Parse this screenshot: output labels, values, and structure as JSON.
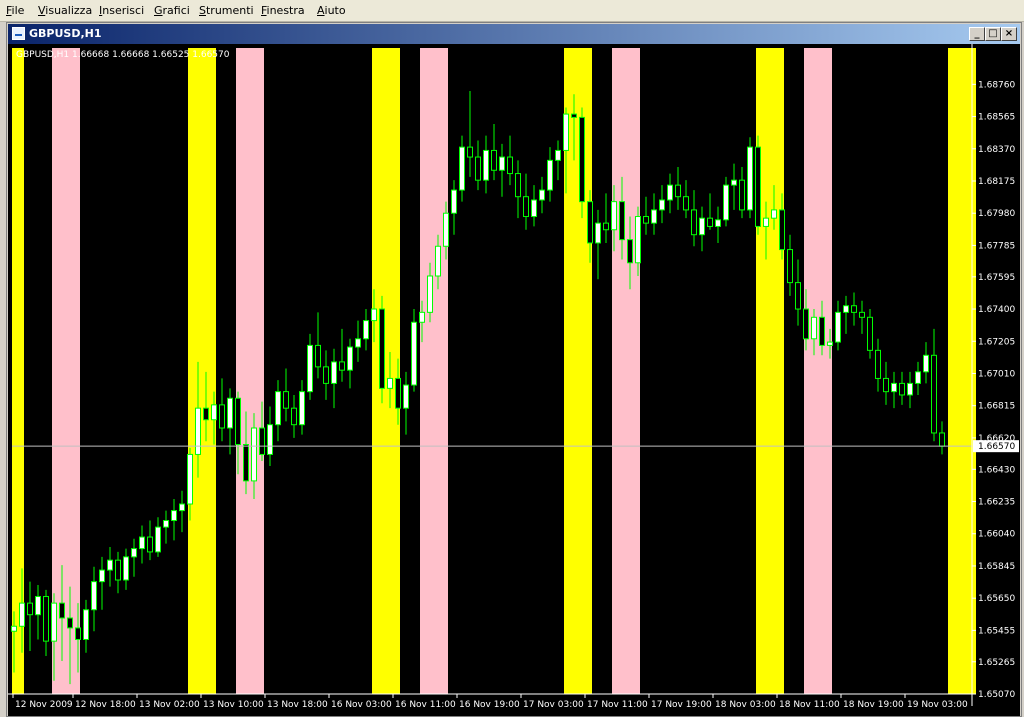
{
  "menu": [
    "File",
    "Visualizza",
    "Inserisci",
    "Grafici",
    "Strumenti",
    "Finestra",
    "Aiuto"
  ],
  "window": {
    "title": "GBPUSD,H1",
    "buttons": {
      "minimize": "_",
      "maximize": "□",
      "close": "×"
    }
  },
  "chart_data": {
    "type": "candlestick",
    "symbol": "GBPUSD",
    "timeframe": "H1",
    "info_line": "GBPUSD,H1  1.66668 1.66668 1.66525 1.66570",
    "current_price": "1.66570",
    "ylim": [
      1.6507,
      1.6898
    ],
    "y_ticks": [
      "1.68760",
      "1.68565",
      "1.68370",
      "1.68175",
      "1.67980",
      "1.67785",
      "1.67595",
      "1.67400",
      "1.67205",
      "1.67010",
      "1.66815",
      "1.66620",
      "1.66430",
      "1.66235",
      "1.66040",
      "1.65845",
      "1.65650",
      "1.65455",
      "1.65265",
      "1.65070"
    ],
    "x_ticks": [
      "12 Nov 2009",
      "12 Nov 18:00",
      "13 Nov 02:00",
      "13 Nov 10:00",
      "13 Nov 18:00",
      "16 Nov 03:00",
      "16 Nov 11:00",
      "16 Nov 19:00",
      "17 Nov 03:00",
      "17 Nov 11:00",
      "17 Nov 19:00",
      "18 Nov 03:00",
      "18 Nov 11:00",
      "18 Nov 19:00",
      "19 Nov 03:00"
    ],
    "session_bands": [
      {
        "type": "yellow",
        "start": 0,
        "end": 1
      },
      {
        "type": "pink",
        "start": 5,
        "end": 8
      },
      {
        "type": "yellow",
        "start": 22,
        "end": 25
      },
      {
        "type": "pink",
        "start": 28,
        "end": 31
      },
      {
        "type": "yellow",
        "start": 45,
        "end": 48
      },
      {
        "type": "pink",
        "start": 51,
        "end": 54
      },
      {
        "type": "yellow",
        "start": 69,
        "end": 72
      },
      {
        "type": "pink",
        "start": 75,
        "end": 78
      },
      {
        "type": "yellow",
        "start": 93,
        "end": 96
      },
      {
        "type": "pink",
        "start": 99,
        "end": 102
      },
      {
        "type": "yellow",
        "start": 117,
        "end": 120
      }
    ],
    "colors": {
      "background": "#000000",
      "up_candle": "#ffffff",
      "down_candle": "#000000",
      "outline": "#00ff00",
      "band_yellow": "#ffff00",
      "band_pink": "#ffc0cb",
      "text": "#ffffff"
    },
    "ohlc": [
      [
        1.6545,
        1.6557,
        1.652,
        1.6548
      ],
      [
        1.6548,
        1.6583,
        1.6532,
        1.6562
      ],
      [
        1.6562,
        1.6575,
        1.6533,
        1.6555
      ],
      [
        1.6555,
        1.6573,
        1.654,
        1.6566
      ],
      [
        1.6566,
        1.657,
        1.653,
        1.6539
      ],
      [
        1.6539,
        1.6568,
        1.6515,
        1.6562
      ],
      [
        1.6562,
        1.6585,
        1.6527,
        1.6553
      ],
      [
        1.6553,
        1.6572,
        1.6513,
        1.6547
      ],
      [
        1.6547,
        1.6562,
        1.652,
        1.654
      ],
      [
        1.654,
        1.6564,
        1.6532,
        1.6558
      ],
      [
        1.6558,
        1.6584,
        1.6545,
        1.6575
      ],
      [
        1.6575,
        1.659,
        1.6558,
        1.6582
      ],
      [
        1.6582,
        1.6596,
        1.6572,
        1.6588
      ],
      [
        1.6588,
        1.6593,
        1.6568,
        1.6576
      ],
      [
        1.6576,
        1.6595,
        1.657,
        1.659
      ],
      [
        1.659,
        1.6601,
        1.6578,
        1.6595
      ],
      [
        1.6595,
        1.6609,
        1.6586,
        1.6602
      ],
      [
        1.6602,
        1.6612,
        1.6588,
        1.6593
      ],
      [
        1.6593,
        1.6614,
        1.659,
        1.6608
      ],
      [
        1.6608,
        1.6618,
        1.6598,
        1.6612
      ],
      [
        1.6612,
        1.6625,
        1.66,
        1.6618
      ],
      [
        1.6618,
        1.663,
        1.6605,
        1.6622
      ],
      [
        1.6622,
        1.6656,
        1.6612,
        1.6652
      ],
      [
        1.6652,
        1.6708,
        1.6638,
        1.668
      ],
      [
        1.668,
        1.6702,
        1.666,
        1.6673
      ],
      [
        1.6673,
        1.669,
        1.6658,
        1.6682
      ],
      [
        1.6682,
        1.6698,
        1.666,
        1.6668
      ],
      [
        1.6668,
        1.6692,
        1.6652,
        1.6686
      ],
      [
        1.6686,
        1.669,
        1.664,
        1.6658
      ],
      [
        1.6658,
        1.6678,
        1.6628,
        1.6636
      ],
      [
        1.6636,
        1.6677,
        1.6625,
        1.6668
      ],
      [
        1.6668,
        1.6684,
        1.6648,
        1.6652
      ],
      [
        1.6652,
        1.6681,
        1.6645,
        1.667
      ],
      [
        1.667,
        1.6697,
        1.666,
        1.669
      ],
      [
        1.669,
        1.6704,
        1.6672,
        1.668
      ],
      [
        1.668,
        1.6688,
        1.6662,
        1.667
      ],
      [
        1.667,
        1.6697,
        1.6664,
        1.669
      ],
      [
        1.669,
        1.6725,
        1.6685,
        1.6718
      ],
      [
        1.6718,
        1.6738,
        1.6698,
        1.6705
      ],
      [
        1.6705,
        1.6715,
        1.6685,
        1.6695
      ],
      [
        1.6695,
        1.6716,
        1.668,
        1.6708
      ],
      [
        1.6708,
        1.6728,
        1.6696,
        1.6703
      ],
      [
        1.6703,
        1.6722,
        1.6692,
        1.6717
      ],
      [
        1.6717,
        1.6733,
        1.6708,
        1.6722
      ],
      [
        1.6722,
        1.674,
        1.6715,
        1.6733
      ],
      [
        1.6733,
        1.6752,
        1.672,
        1.674
      ],
      [
        1.674,
        1.6748,
        1.6683,
        1.6692
      ],
      [
        1.6692,
        1.6714,
        1.668,
        1.6698
      ],
      [
        1.6698,
        1.671,
        1.667,
        1.668
      ],
      [
        1.668,
        1.6702,
        1.6664,
        1.6694
      ],
      [
        1.6694,
        1.674,
        1.669,
        1.6732
      ],
      [
        1.6732,
        1.6745,
        1.672,
        1.6738
      ],
      [
        1.6738,
        1.6768,
        1.6732,
        1.676
      ],
      [
        1.676,
        1.6785,
        1.6752,
        1.6778
      ],
      [
        1.6778,
        1.6805,
        1.677,
        1.6798
      ],
      [
        1.6798,
        1.6818,
        1.6785,
        1.6812
      ],
      [
        1.6812,
        1.6845,
        1.6805,
        1.6838
      ],
      [
        1.6838,
        1.6872,
        1.682,
        1.6832
      ],
      [
        1.6832,
        1.6842,
        1.6812,
        1.6818
      ],
      [
        1.6818,
        1.6845,
        1.681,
        1.6836
      ],
      [
        1.6836,
        1.6852,
        1.6818,
        1.6824
      ],
      [
        1.6824,
        1.684,
        1.6808,
        1.6832
      ],
      [
        1.6832,
        1.6845,
        1.6815,
        1.6822
      ],
      [
        1.6822,
        1.683,
        1.6795,
        1.6808
      ],
      [
        1.6808,
        1.6822,
        1.6788,
        1.6796
      ],
      [
        1.6796,
        1.6815,
        1.679,
        1.6806
      ],
      [
        1.6806,
        1.682,
        1.6798,
        1.6812
      ],
      [
        1.6812,
        1.6838,
        1.6805,
        1.683
      ],
      [
        1.683,
        1.6842,
        1.6818,
        1.6836
      ],
      [
        1.6836,
        1.6862,
        1.681,
        1.6858
      ],
      [
        1.6858,
        1.687,
        1.683,
        1.6856
      ],
      [
        1.6856,
        1.6862,
        1.6795,
        1.6805
      ],
      [
        1.6805,
        1.6812,
        1.6768,
        1.678
      ],
      [
        1.678,
        1.68,
        1.6758,
        1.6792
      ],
      [
        1.6792,
        1.681,
        1.678,
        1.6788
      ],
      [
        1.6788,
        1.6815,
        1.6775,
        1.6805
      ],
      [
        1.6805,
        1.682,
        1.677,
        1.6782
      ],
      [
        1.6782,
        1.6796,
        1.6752,
        1.6768
      ],
      [
        1.6768,
        1.6802,
        1.676,
        1.6796
      ],
      [
        1.6796,
        1.6808,
        1.6785,
        1.6792
      ],
      [
        1.6792,
        1.681,
        1.6785,
        1.68
      ],
      [
        1.68,
        1.6815,
        1.6792,
        1.6806
      ],
      [
        1.6806,
        1.6822,
        1.6798,
        1.6815
      ],
      [
        1.6815,
        1.6826,
        1.68,
        1.6808
      ],
      [
        1.6808,
        1.6818,
        1.6795,
        1.68
      ],
      [
        1.68,
        1.6812,
        1.6778,
        1.6785
      ],
      [
        1.6785,
        1.6802,
        1.6775,
        1.6795
      ],
      [
        1.6795,
        1.681,
        1.6788,
        1.679
      ],
      [
        1.679,
        1.6802,
        1.678,
        1.6794
      ],
      [
        1.6794,
        1.682,
        1.679,
        1.6815
      ],
      [
        1.6815,
        1.6828,
        1.68,
        1.6818
      ],
      [
        1.6818,
        1.6826,
        1.6795,
        1.68
      ],
      [
        1.68,
        1.6844,
        1.6795,
        1.6838
      ],
      [
        1.6838,
        1.6845,
        1.6785,
        1.679
      ],
      [
        1.679,
        1.6805,
        1.677,
        1.6795
      ],
      [
        1.6795,
        1.6815,
        1.6788,
        1.68
      ],
      [
        1.68,
        1.681,
        1.677,
        1.6776
      ],
      [
        1.6776,
        1.6785,
        1.6748,
        1.6756
      ],
      [
        1.6756,
        1.677,
        1.673,
        1.674
      ],
      [
        1.674,
        1.6752,
        1.6715,
        1.6722
      ],
      [
        1.6722,
        1.674,
        1.6712,
        1.6735
      ],
      [
        1.6735,
        1.6745,
        1.6712,
        1.6718
      ],
      [
        1.6718,
        1.6728,
        1.671,
        1.672
      ],
      [
        1.672,
        1.6745,
        1.6715,
        1.6738
      ],
      [
        1.6738,
        1.6748,
        1.6725,
        1.6742
      ],
      [
        1.6742,
        1.675,
        1.673,
        1.6738
      ],
      [
        1.6738,
        1.6745,
        1.6725,
        1.6735
      ],
      [
        1.6735,
        1.674,
        1.671,
        1.6715
      ],
      [
        1.6715,
        1.6722,
        1.669,
        1.6698
      ],
      [
        1.6698,
        1.6708,
        1.6682,
        1.669
      ],
      [
        1.669,
        1.6702,
        1.668,
        1.6695
      ],
      [
        1.6695,
        1.6702,
        1.6682,
        1.6688
      ],
      [
        1.6688,
        1.6702,
        1.668,
        1.6695
      ],
      [
        1.6695,
        1.6708,
        1.6688,
        1.6702
      ],
      [
        1.6702,
        1.672,
        1.6695,
        1.6712
      ],
      [
        1.6712,
        1.6728,
        1.666,
        1.6665
      ],
      [
        1.6665,
        1.6672,
        1.6652,
        1.6657
      ]
    ]
  }
}
